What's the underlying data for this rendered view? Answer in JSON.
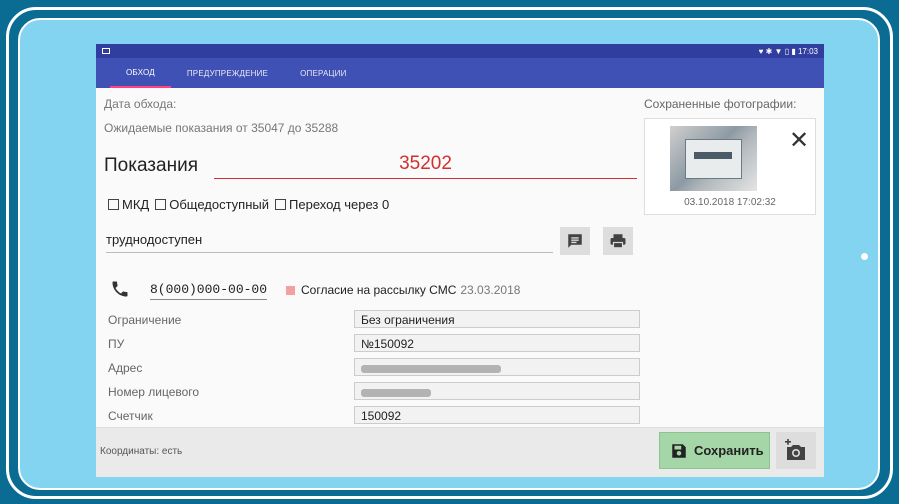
{
  "status_bar": {
    "time": "17:03",
    "icons": "♥ ✱ ▼ ▯ ▮"
  },
  "tabs": [
    {
      "label": "ОБХОД",
      "active": true
    },
    {
      "label": "ПРЕДУПРЕЖДЕНИЕ",
      "active": false
    },
    {
      "label": "ОПЕРАЦИИ",
      "active": false
    }
  ],
  "form": {
    "visit_date_label": "Дата обхода:",
    "expected_readings": "Ожидаемые показания от 35047 до 35288",
    "readings_label": "Показания",
    "readings_value": "35202",
    "checkboxes": [
      {
        "label": "МКД",
        "checked": false
      },
      {
        "label": "Общедоступный",
        "checked": false
      },
      {
        "label": "Переход через 0",
        "checked": false
      }
    ],
    "remark_value": "труднодоступен",
    "phone": "8(000)000-00-00",
    "sms_consent_label": "Согласие на рассылку СМС",
    "sms_consent_date": "23.03.2018",
    "details": [
      {
        "label": "Ограничение",
        "value": "Без ограничения"
      },
      {
        "label": "ПУ",
        "value": "№150092"
      },
      {
        "label": "Адрес",
        "value": ""
      },
      {
        "label": "Номер лицевого",
        "value": ""
      },
      {
        "label": "Счетчик",
        "value": "150092"
      }
    ]
  },
  "photos": {
    "title": "Сохраненные фотографии:",
    "items": [
      {
        "date": "03.10.2018 17:02:32"
      }
    ]
  },
  "bottom": {
    "coords": "Координаты: есть",
    "save_label": "Сохранить"
  },
  "colors": {
    "accent": "#3f51b5",
    "readings": "#d32f2f",
    "save": "#a5d6a7"
  }
}
